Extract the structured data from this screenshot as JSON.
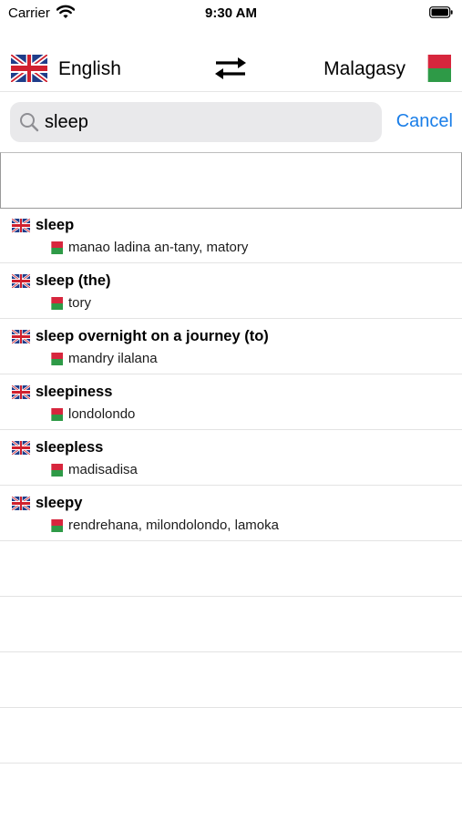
{
  "status_bar": {
    "carrier": "Carrier",
    "time": "9:30 AM"
  },
  "languages": {
    "source": "English",
    "target": "Malagasy"
  },
  "search": {
    "value": "sleep",
    "cancel_label": "Cancel"
  },
  "results": [
    {
      "headword": "sleep",
      "translation": "manao ladina an-tany, matory"
    },
    {
      "headword": "sleep (the)",
      "translation": "tory"
    },
    {
      "headword": "sleep overnight on a journey (to)",
      "translation": "mandry ilalana"
    },
    {
      "headword": "sleepiness",
      "translation": "londolondo"
    },
    {
      "headword": "sleepless",
      "translation": "madisadisa"
    },
    {
      "headword": "sleepy",
      "translation": "rendrehana, milondolondo, lamoka"
    }
  ],
  "icons": {
    "source_flag": "uk-flag-icon",
    "target_flag": "madagascar-flag-icon",
    "swap": "swap-arrows-icon",
    "search": "magnifier-icon"
  },
  "colors": {
    "accent": "#1a7ee8",
    "search_bg": "#e9e9eb",
    "mg_red": "#d7263d",
    "mg_green": "#2e9a47",
    "uk_blue": "#1f3d8a",
    "uk_red": "#d0202e"
  }
}
